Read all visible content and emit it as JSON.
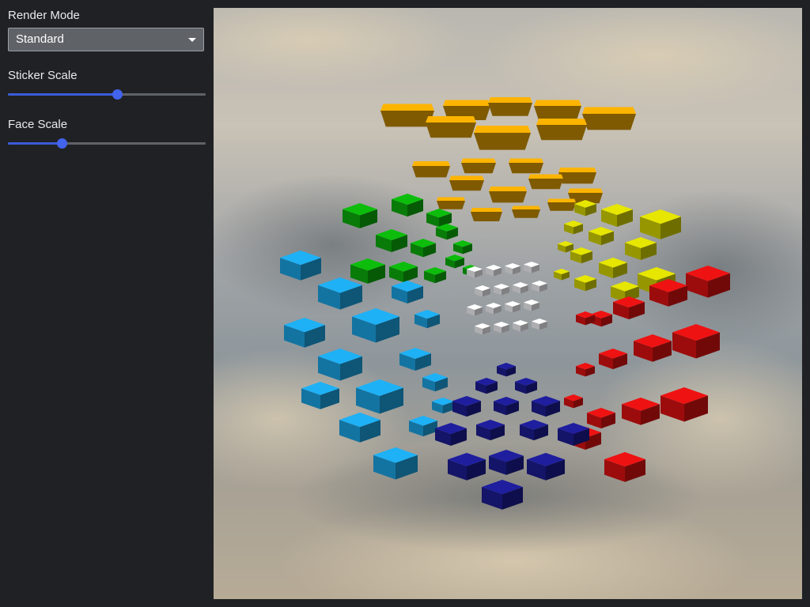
{
  "sidebar": {
    "render_mode_label": "Render Mode",
    "render_mode_value": "Standard",
    "sticker_scale_label": "Sticker Scale",
    "sticker_scale_value": 0.55,
    "face_scale_label": "Face Scale",
    "face_scale_value": 0.27
  },
  "viewport": {
    "faces": [
      {
        "name": "top",
        "color": "#e6a400"
      },
      {
        "name": "left-upper",
        "color": "#0aa40a"
      },
      {
        "name": "right-upper",
        "color": "#c8c800"
      },
      {
        "name": "center",
        "color": "#e8e8ec"
      },
      {
        "name": "left-lower",
        "color": "#1a9ad6"
      },
      {
        "name": "right-lower",
        "color": "#d01010"
      },
      {
        "name": "bottom",
        "color": "#1a1a8a"
      }
    ]
  }
}
